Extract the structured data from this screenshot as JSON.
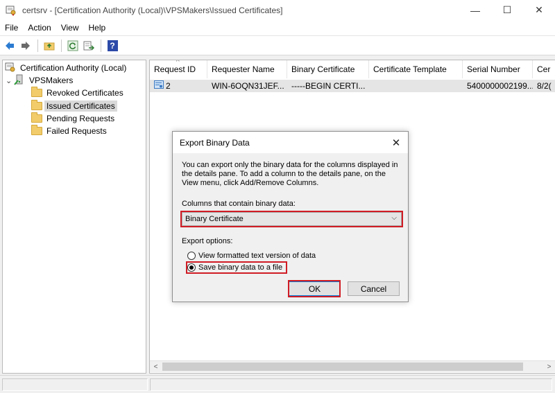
{
  "window": {
    "title": "certsrv - [Certification Authority (Local)\\VPSMakers\\Issued Certificates]",
    "minimize_glyph": "—",
    "maximize_glyph": "☐",
    "close_glyph": "✕"
  },
  "menu": {
    "items": [
      "File",
      "Action",
      "View",
      "Help"
    ]
  },
  "toolbar": {
    "icons": [
      "back-arrow-icon",
      "forward-arrow-icon",
      "up-folder-icon",
      "refresh-icon",
      "export-list-icon",
      "help-icon"
    ],
    "help_glyph": "?"
  },
  "tree": {
    "root": "Certification Authority (Local)",
    "ca": "VPSMakers",
    "expander_glyph": "⌄",
    "folders": [
      "Revoked Certificates",
      "Issued Certificates",
      "Pending Requests",
      "Failed Requests"
    ],
    "selected": "Issued Certificates"
  },
  "list": {
    "columns": [
      "Request ID",
      "Requester Name",
      "Binary Certificate",
      "Certificate Template",
      "Serial Number",
      "Cer"
    ],
    "sort_glyph": "^",
    "rows": [
      {
        "request_id": "2",
        "requester_name": "WIN-6OQN31JEF...",
        "binary_certificate": "-----BEGIN CERTI...",
        "certificate_template": "",
        "serial_number": "5400000002199...",
        "cer": "8/2("
      }
    ]
  },
  "scrollbar": {
    "left_glyph": "<",
    "right_glyph": ">"
  },
  "dialog": {
    "title": "Export Binary Data",
    "close_glyph": "✕",
    "description_lines": [
      "You can export only the binary data for the columns displayed in",
      "the details pane. To add a column to the details pane, on the",
      "View menu, click Add/Remove Columns."
    ],
    "columns_label": "Columns that contain binary data:",
    "columns_value": "Binary Certificate",
    "chevron_glyph": "⌵",
    "export_options_label": "Export options:",
    "options": [
      {
        "label": "View formatted text version of data",
        "checked": false
      },
      {
        "label": "Save binary data to a file",
        "checked": true
      }
    ],
    "ok_label": "OK",
    "cancel_label": "Cancel",
    "highlight_color": "#d01c24"
  }
}
